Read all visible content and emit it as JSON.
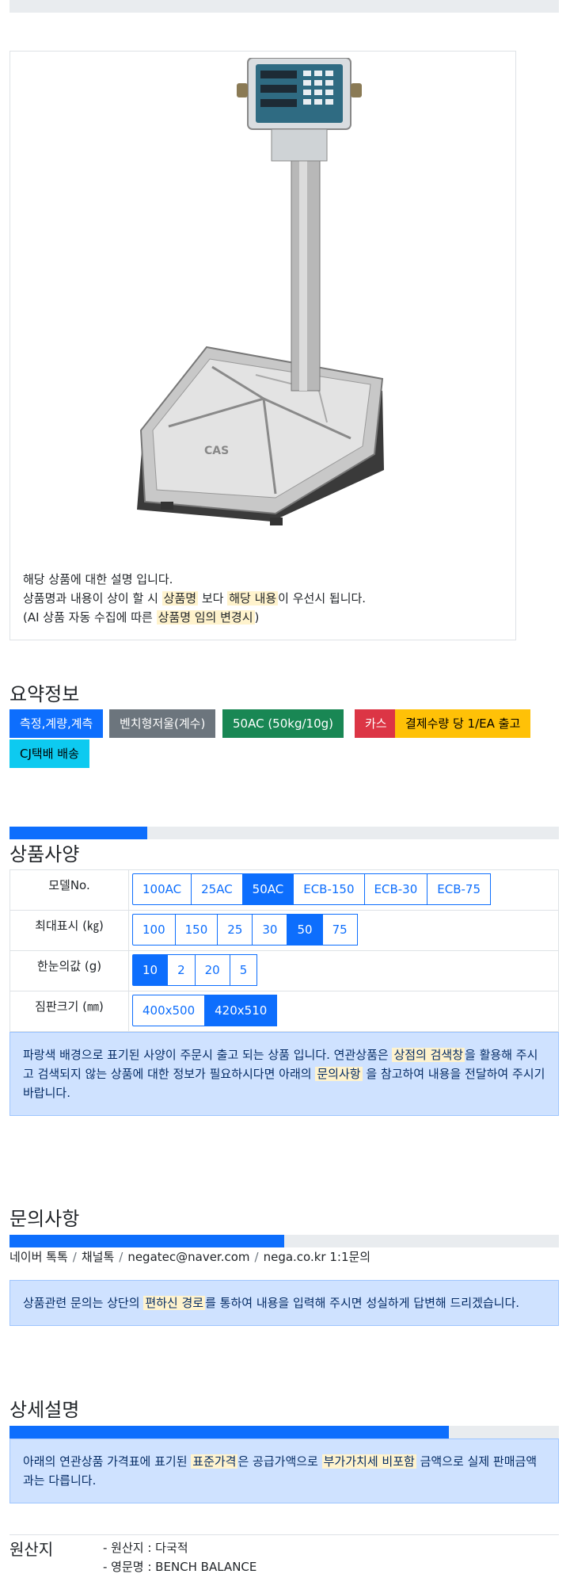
{
  "product": {
    "image_alt": "CAS bench scale",
    "brand_on_image": "CAS",
    "description": {
      "line1": "해당 상품에 대한 설명 입니다.",
      "line2_a": "상품명과 내용이 상이 할 시 ",
      "line2_hl1": "상품명",
      "line2_b": " 보다 ",
      "line2_hl2": "해당 내용",
      "line2_c": "이 우선시 됩니다.",
      "line3_a": "(AI 상품 자동 수집에 따른 ",
      "line3_hl": "상품명 임의 변경시",
      "line3_b": ")"
    }
  },
  "summary": {
    "title": "요약정보",
    "tags": [
      {
        "label": "측정,계량,계측",
        "bg": "#0d6efd",
        "fg": "#ffffff"
      },
      {
        "label": "벤치형저울(계수)",
        "bg": "#6c757d",
        "fg": "#ffffff"
      },
      {
        "label": "50AC (50kg/10g)",
        "bg": "#198754",
        "fg": "#ffffff"
      },
      {
        "label": "카스",
        "bg": "#dc3545",
        "fg": "#ffffff"
      },
      {
        "label": "결제수량 당 1/EA 출고",
        "bg": "#ffc107",
        "fg": "#000000"
      },
      {
        "label": "CJ택배 배송",
        "bg": "#0dcaf0",
        "fg": "#000000"
      }
    ]
  },
  "spec": {
    "title": "상품사양",
    "progress": 0.25,
    "rows": [
      {
        "label": "모델No.",
        "options": [
          "100AC",
          "25AC",
          "50AC",
          "ECB-150",
          "ECB-30",
          "ECB-75"
        ],
        "selected": "50AC"
      },
      {
        "label": "최대표시 (㎏)",
        "options": [
          "100",
          "150",
          "25",
          "30",
          "50",
          "75"
        ],
        "selected": "50"
      },
      {
        "label": "한눈의값 (g)",
        "options": [
          "10",
          "2",
          "20",
          "5"
        ],
        "selected": "10"
      },
      {
        "label": "짐판크기 (㎜)",
        "options": [
          "400x500",
          "420x510"
        ],
        "selected": "420x510"
      }
    ],
    "notice": {
      "a": "파랑색 배경으로 표기된 사양이 주문시 출고 되는 상품 입니다. 연관상품은 ",
      "hl1": "상점의 검색창",
      "b": "을 활용해 주시고 검색되지 않는 상품에 대한 정보가 필요하시다면 아래의 ",
      "hl2": "문의사항",
      "c": " 을 참고하여 내용을 전달하여 주시기 바랍니다."
    }
  },
  "inquiry": {
    "title": "문의사항",
    "progress": 0.5,
    "links": [
      "네이버 톡톡",
      "채널톡",
      "negatec@naver.com",
      "nega.co.kr 1:1문의"
    ],
    "separator": "/",
    "notice": {
      "a": "상품관련 문의는 상단의 ",
      "hl": "편하신 경로",
      "b": "를 통하여 내용을 입력해 주시면 성실하게 답변해 드리겠습니다."
    }
  },
  "detail": {
    "title": "상세설명",
    "progress": 0.8,
    "notice": {
      "a": "아래의 연관상품 가격표에 표기된 ",
      "hl1": "표준가격",
      "b": "은 공급가액으로 ",
      "hl2": "부가가치세 비포함",
      "c": " 금액으로 실제 판매금액과는 다릅니다."
    }
  },
  "origin": {
    "label": "원산지",
    "items": [
      "- 원산지 : 다국적",
      "- 영문명 : BENCH BALANCE"
    ]
  },
  "colors": {
    "primary": "#0d6efd",
    "highlight": "#fff3cd",
    "alert_bg": "#cfe2ff"
  }
}
